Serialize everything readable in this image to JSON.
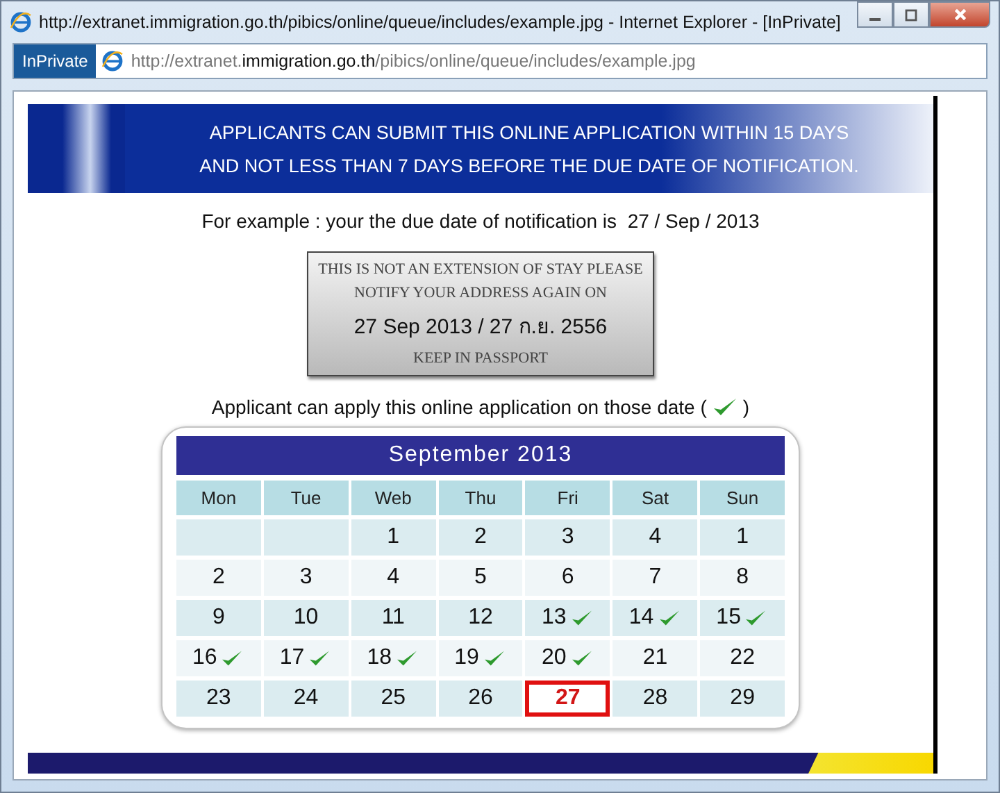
{
  "window": {
    "title": "http://extranet.immigration.go.th/pibics/online/queue/includes/example.jpg - Internet Explorer - [InPrivate]"
  },
  "address_bar": {
    "badge": "InPrivate",
    "url_parts": [
      {
        "text": "http://extranet.",
        "emphasized": false
      },
      {
        "text": "immigration.go.th",
        "emphasized": true
      },
      {
        "text": "/pibics/online/queue/includes/example.jpg",
        "emphasized": false
      }
    ]
  },
  "image": {
    "banner_lines": [
      "APPLICANTS CAN SUBMIT THIS ONLINE APPLICATION WITHIN 15 DAYS",
      "AND NOT LESS THAN 7 DAYS BEFORE THE DUE DATE OF NOTIFICATION."
    ],
    "example_line": "For example : your the due date of notification is  27 / Sep / 2013",
    "stamp": {
      "lines": [
        "THIS IS NOT AN EXTENSION OF STAY PLEASE",
        "NOTIFY YOUR ADDRESS AGAIN ON"
      ],
      "date": "27 Sep 2013 / 27 ก.ย. 2556",
      "footer": "KEEP IN PASSPORT"
    },
    "apply_line": {
      "before": "Applicant can apply this online application on those date (",
      "after": ")"
    },
    "calendar": {
      "title": "September 2013",
      "weekdays": [
        "Mon",
        "Tue",
        "Web",
        "Thu",
        "Fri",
        "Sat",
        "Sun"
      ],
      "weeks": [
        [
          {
            "checked": false,
            "highlighted": false
          },
          {
            "checked": false,
            "highlighted": false
          },
          {
            "text": "1",
            "checked": false,
            "highlighted": false
          },
          {
            "text": "2",
            "checked": false,
            "highlighted": false
          },
          {
            "text": "3",
            "checked": false,
            "highlighted": false
          },
          {
            "text": "4",
            "checked": false,
            "highlighted": false
          },
          {
            "text": "1",
            "checked": false,
            "highlighted": false
          }
        ],
        [
          {
            "text": "2",
            "checked": false,
            "highlighted": false
          },
          {
            "text": "3",
            "checked": false,
            "highlighted": false
          },
          {
            "text": "4",
            "checked": false,
            "highlighted": false
          },
          {
            "text": "5",
            "checked": false,
            "highlighted": false
          },
          {
            "text": "6",
            "checked": false,
            "highlighted": false
          },
          {
            "text": "7",
            "checked": false,
            "highlighted": false
          },
          {
            "text": "8",
            "checked": false,
            "highlighted": false
          }
        ],
        [
          {
            "text": "9",
            "checked": false,
            "highlighted": false
          },
          {
            "text": "10",
            "checked": false,
            "highlighted": false
          },
          {
            "text": "11",
            "checked": false,
            "highlighted": false
          },
          {
            "text": "12",
            "checked": false,
            "highlighted": false
          },
          {
            "text": "13",
            "checked": true,
            "highlighted": false
          },
          {
            "text": "14",
            "checked": true,
            "highlighted": false
          },
          {
            "text": "15",
            "checked": true,
            "highlighted": false
          }
        ],
        [
          {
            "text": "16",
            "checked": true,
            "highlighted": false
          },
          {
            "text": "17",
            "checked": true,
            "highlighted": false
          },
          {
            "text": "18",
            "checked": true,
            "highlighted": false
          },
          {
            "text": "19",
            "checked": true,
            "highlighted": false
          },
          {
            "text": "20",
            "checked": true,
            "highlighted": false
          },
          {
            "text": "21",
            "checked": false,
            "highlighted": false
          },
          {
            "text": "22",
            "checked": false,
            "highlighted": false
          }
        ],
        [
          {
            "text": "23",
            "checked": false,
            "highlighted": false
          },
          {
            "text": "24",
            "checked": false,
            "highlighted": false
          },
          {
            "text": "25",
            "checked": false,
            "highlighted": false
          },
          {
            "text": "26",
            "checked": false,
            "highlighted": false
          },
          {
            "text": "27",
            "checked": false,
            "highlighted": true
          },
          {
            "text": "28",
            "checked": false,
            "highlighted": false
          },
          {
            "text": "29",
            "checked": false,
            "highlighted": false
          }
        ]
      ]
    }
  }
}
